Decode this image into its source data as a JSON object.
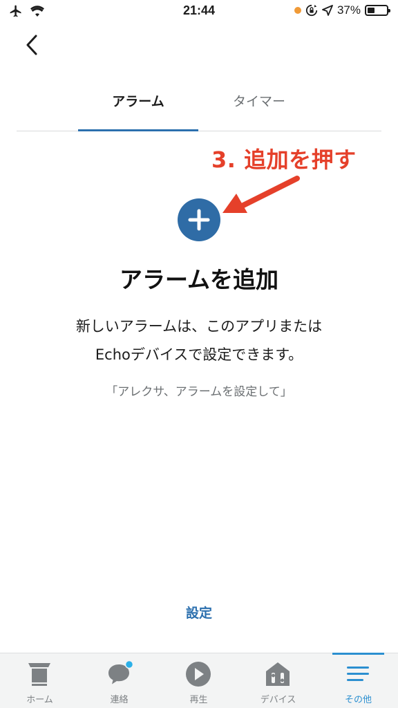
{
  "status_bar": {
    "time": "21:44",
    "battery": "37%",
    "battery_level": 0.37
  },
  "nav": {
    "back_icon": "chevron-left-icon"
  },
  "tabs": [
    {
      "label": "アラーム",
      "active": true
    },
    {
      "label": "タイマー",
      "active": false
    }
  ],
  "annotation": {
    "text": "3. 追加を押す",
    "color": "#e5402a"
  },
  "main": {
    "title": "アラームを追加",
    "description_line1": "新しいアラームは、このアプリまたは",
    "description_line2": "Echoデバイスで設定できます。",
    "hint": "「アレクサ、アラームを設定して」",
    "settings_label": "設定"
  },
  "colors": {
    "accent": "#2b6fae",
    "add_button": "#2f6ca6",
    "nav_active": "#2b8fd0"
  },
  "bottom_nav": [
    {
      "label": "ホーム",
      "icon": "home-icon",
      "active": false
    },
    {
      "label": "連絡",
      "icon": "chat-bubble-icon",
      "active": false,
      "badge": true
    },
    {
      "label": "再生",
      "icon": "play-icon",
      "active": false
    },
    {
      "label": "デバイス",
      "icon": "devices-house-icon",
      "active": false
    },
    {
      "label": "その他",
      "icon": "menu-icon",
      "active": true
    }
  ]
}
